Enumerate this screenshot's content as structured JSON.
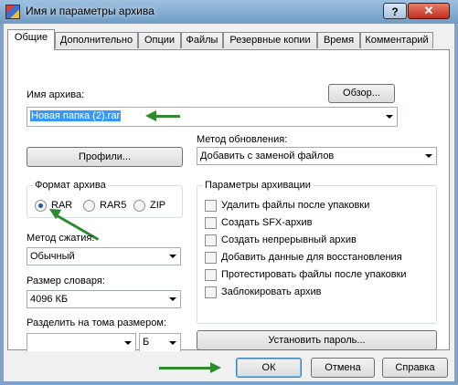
{
  "window": {
    "title": "Имя и параметры архива",
    "help_glyph": "?",
    "close_glyph": "✕"
  },
  "tabs": [
    "Общие",
    "Дополнительно",
    "Опции",
    "Файлы",
    "Резервные копии",
    "Время",
    "Комментарий"
  ],
  "archive_name": {
    "label": "Имя архива:",
    "value": "Новая папка (2).rar",
    "browse_label": "Обзор..."
  },
  "profiles_label": "Профили...",
  "update_method": {
    "label": "Метод обновления:",
    "value": "Добавить с заменой файлов"
  },
  "archive_format": {
    "caption": "Формат архива",
    "options": [
      "RAR",
      "RAR5",
      "ZIP"
    ],
    "selected": "RAR"
  },
  "compression": {
    "label": "Метод сжатия:",
    "value": "Обычный"
  },
  "dictionary": {
    "label": "Размер словаря:",
    "value": "4096 КБ"
  },
  "split": {
    "label": "Разделить на тома размером:",
    "value": "",
    "unit": "Б"
  },
  "archive_params": {
    "caption": "Параметры архивации",
    "options": [
      "Удалить файлы после упаковки",
      "Создать SFX-архив",
      "Создать непрерывный архив",
      "Добавить данные для восстановления",
      "Протестировать файлы после упаковки",
      "Заблокировать архив"
    ]
  },
  "set_password_label": "Установить пароль...",
  "footer": {
    "ok": "ОК",
    "cancel": "Отмена",
    "help": "Справка"
  },
  "colors": {
    "annotation_arrow": "#2e8b2e",
    "selection": "#3399ff",
    "radio_dot": "#1f56a8"
  }
}
